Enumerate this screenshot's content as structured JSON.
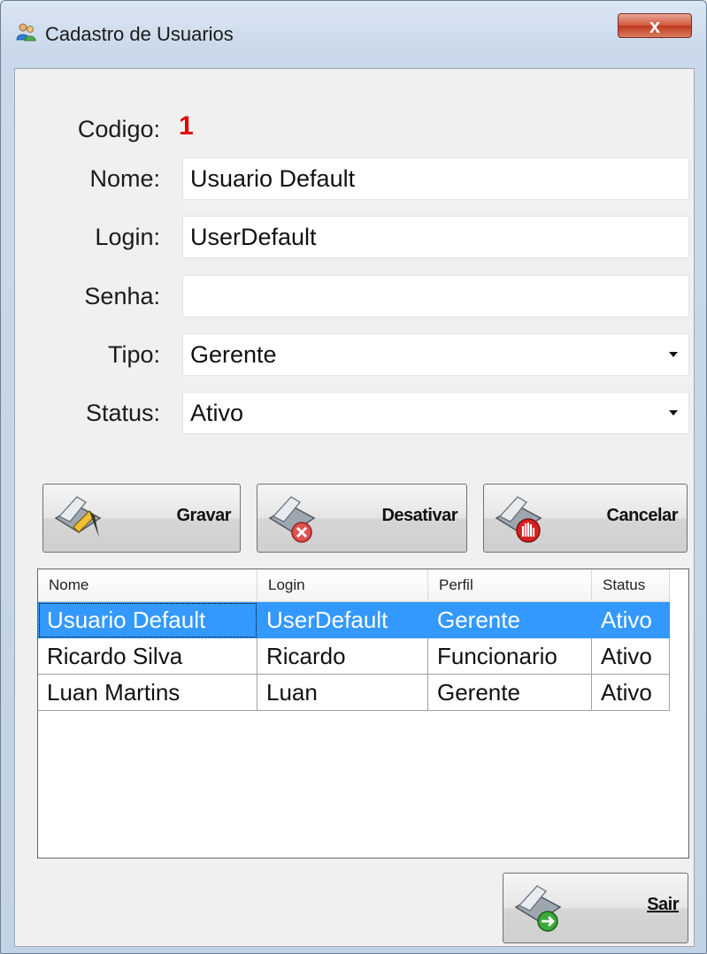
{
  "window": {
    "title": "Cadastro de Usuarios",
    "close_glyph": "x"
  },
  "form": {
    "codigo_label": "Codigo:",
    "codigo_value": "1",
    "nome_label": "Nome:",
    "nome_value": "Usuario Default",
    "login_label": "Login:",
    "login_value": "UserDefault",
    "senha_label": "Senha:",
    "senha_value": "",
    "tipo_label": "Tipo:",
    "tipo_value": "Gerente",
    "status_label": "Status:",
    "status_value": "Ativo"
  },
  "buttons": {
    "gravar": "Gravar",
    "desativar": "Desativar",
    "cancelar": "Cancelar",
    "sair": "Sair"
  },
  "grid": {
    "columns": [
      "Nome",
      "Login",
      "Perfil",
      "Status"
    ],
    "rows": [
      [
        "Usuario Default",
        "UserDefault",
        "Gerente",
        "Ativo"
      ],
      [
        "Ricardo Silva",
        "Ricardo",
        "Funcionario",
        "Ativo"
      ],
      [
        "Luan Martins",
        "Luan",
        "Gerente",
        "Ativo"
      ]
    ],
    "selected_row": 0
  },
  "colors": {
    "accent": "#3399ff",
    "codigo": "#e00000",
    "close": "#c1371d"
  },
  "icons": [
    "users-app-icon",
    "close-icon",
    "gravar-pencil-icon",
    "desativar-icon",
    "cancelar-hand-icon",
    "sair-arrow-icon",
    "dropdown-arrow-icon"
  ]
}
